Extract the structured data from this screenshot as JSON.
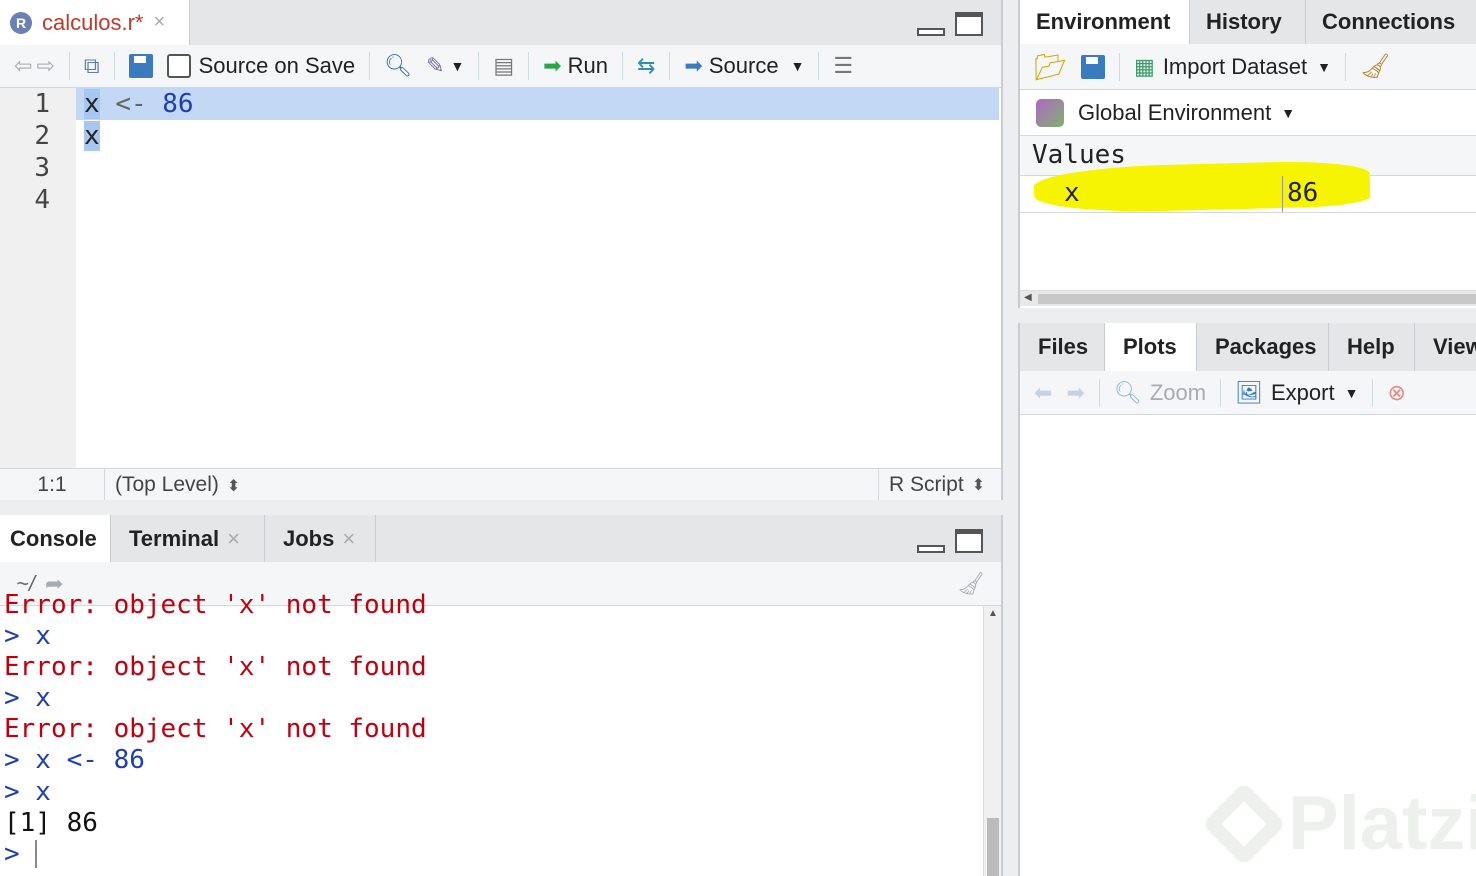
{
  "editor": {
    "tab": {
      "title": "calculos.r*",
      "close": "×",
      "r_logo": "R"
    },
    "toolbar": {
      "source_on_save": "Source on Save",
      "run": "Run",
      "source": "Source"
    },
    "line_numbers": [
      "1",
      "2",
      "3",
      "4"
    ],
    "code": [
      {
        "var": "x",
        "op": "<-",
        "num": "86"
      },
      {
        "var": "x"
      }
    ],
    "status": {
      "position": "1:1",
      "scope": "(Top Level)",
      "filetype": "R Script"
    }
  },
  "console": {
    "tabs": [
      {
        "label": "Console"
      },
      {
        "label": "Terminal",
        "close": "×"
      },
      {
        "label": "Jobs",
        "close": "×"
      }
    ],
    "path": "~/",
    "lines": [
      {
        "type": "err",
        "text": "Error: object 'x' not found"
      },
      {
        "type": "prompt",
        "text": "> x"
      },
      {
        "type": "err",
        "text": "Error: object 'x' not found"
      },
      {
        "type": "prompt",
        "text": "> x"
      },
      {
        "type": "err",
        "text": "Error: object 'x' not found"
      },
      {
        "type": "prompt",
        "text": "> x <- 86"
      },
      {
        "type": "prompt",
        "text": "> x"
      },
      {
        "type": "out",
        "text": "[1] 86"
      },
      {
        "type": "prompt",
        "text": "> "
      }
    ]
  },
  "environment": {
    "tabs": [
      "Environment",
      "History",
      "Connections"
    ],
    "import_dataset": "Import Dataset",
    "global_env": "Global Environment",
    "values_header": "Values",
    "variables": [
      {
        "name": "x",
        "value": "86"
      }
    ]
  },
  "files": {
    "tabs": [
      "Files",
      "Plots",
      "Packages",
      "Help",
      "Viewer"
    ],
    "zoom": "Zoom",
    "export": "Export"
  },
  "watermark": "Platzi",
  "colors": {
    "accent": "#1f3fb0",
    "error": "#c0000e",
    "highlight": "#f6f400",
    "selection": "#c3d8f5"
  }
}
